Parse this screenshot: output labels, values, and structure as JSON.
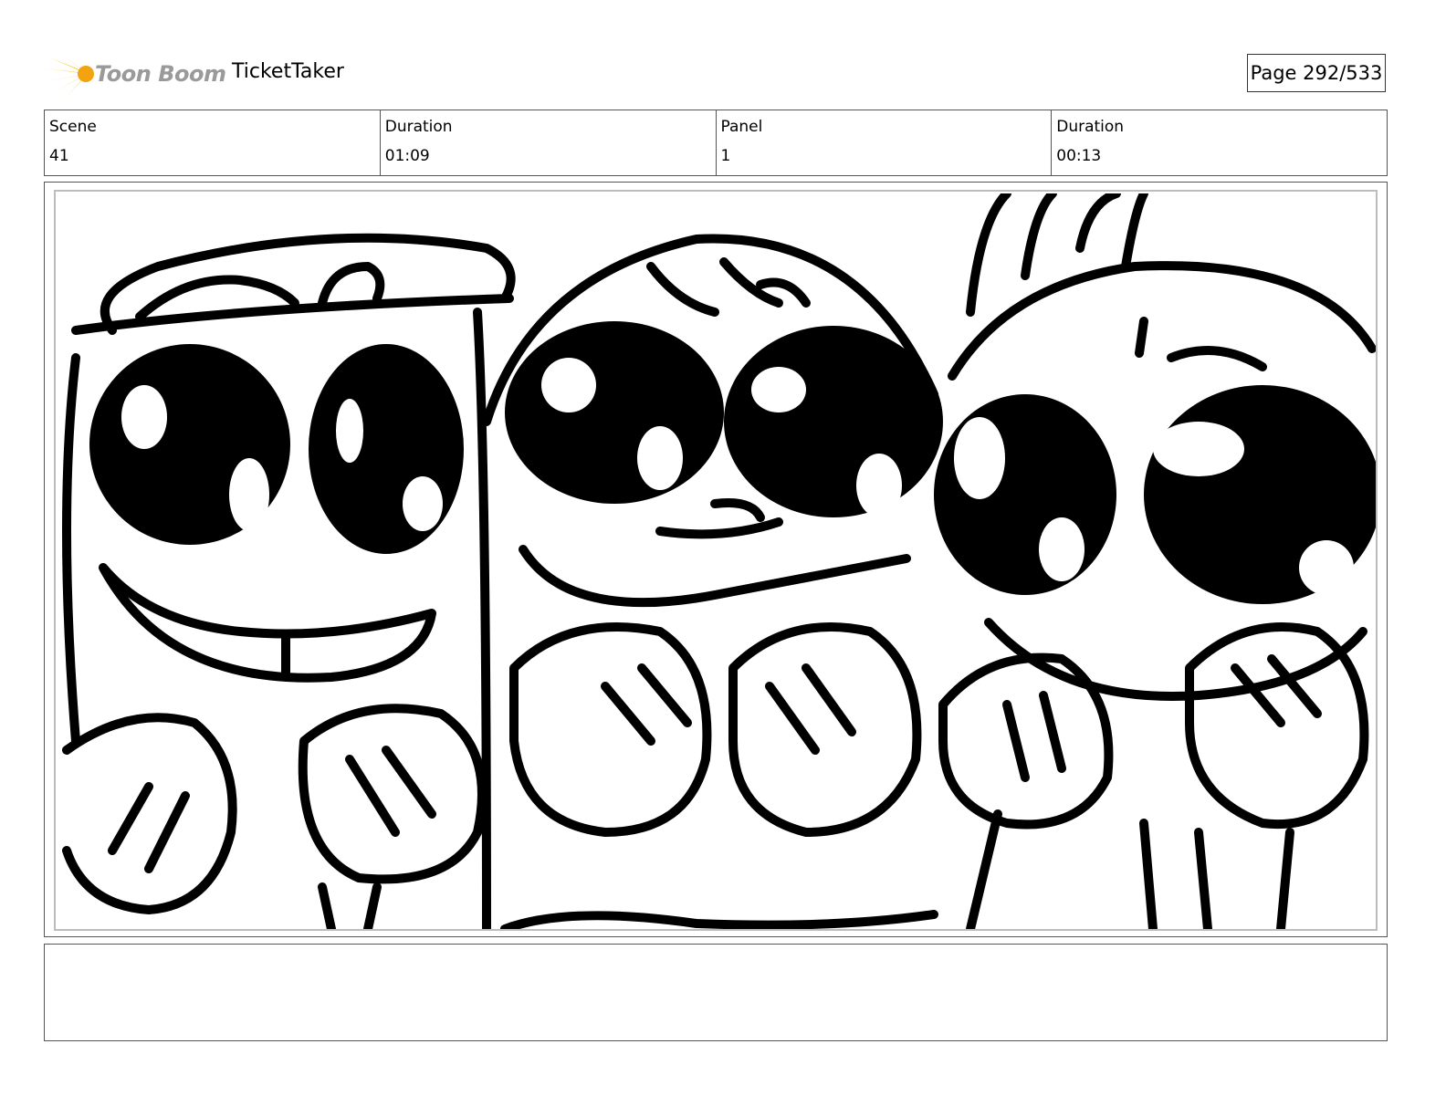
{
  "header": {
    "logo_text": "Toon Boom",
    "project_title": "TicketTaker",
    "page_label": "Page 292/533"
  },
  "info": [
    {
      "label": "Scene",
      "value": "41"
    },
    {
      "label": "Duration",
      "value": "01:09"
    },
    {
      "label": "Panel",
      "value": "1"
    },
    {
      "label": "Duration",
      "value": "00:13"
    }
  ],
  "panel": {
    "drawing": "storyboard-sketch-three-characters"
  },
  "notes": {
    "text": ""
  },
  "colors": {
    "logo_accent": "#f2c40f",
    "logo_text": "#9a9a9a",
    "border": "#555555",
    "inner_border": "#bcbcbc"
  }
}
